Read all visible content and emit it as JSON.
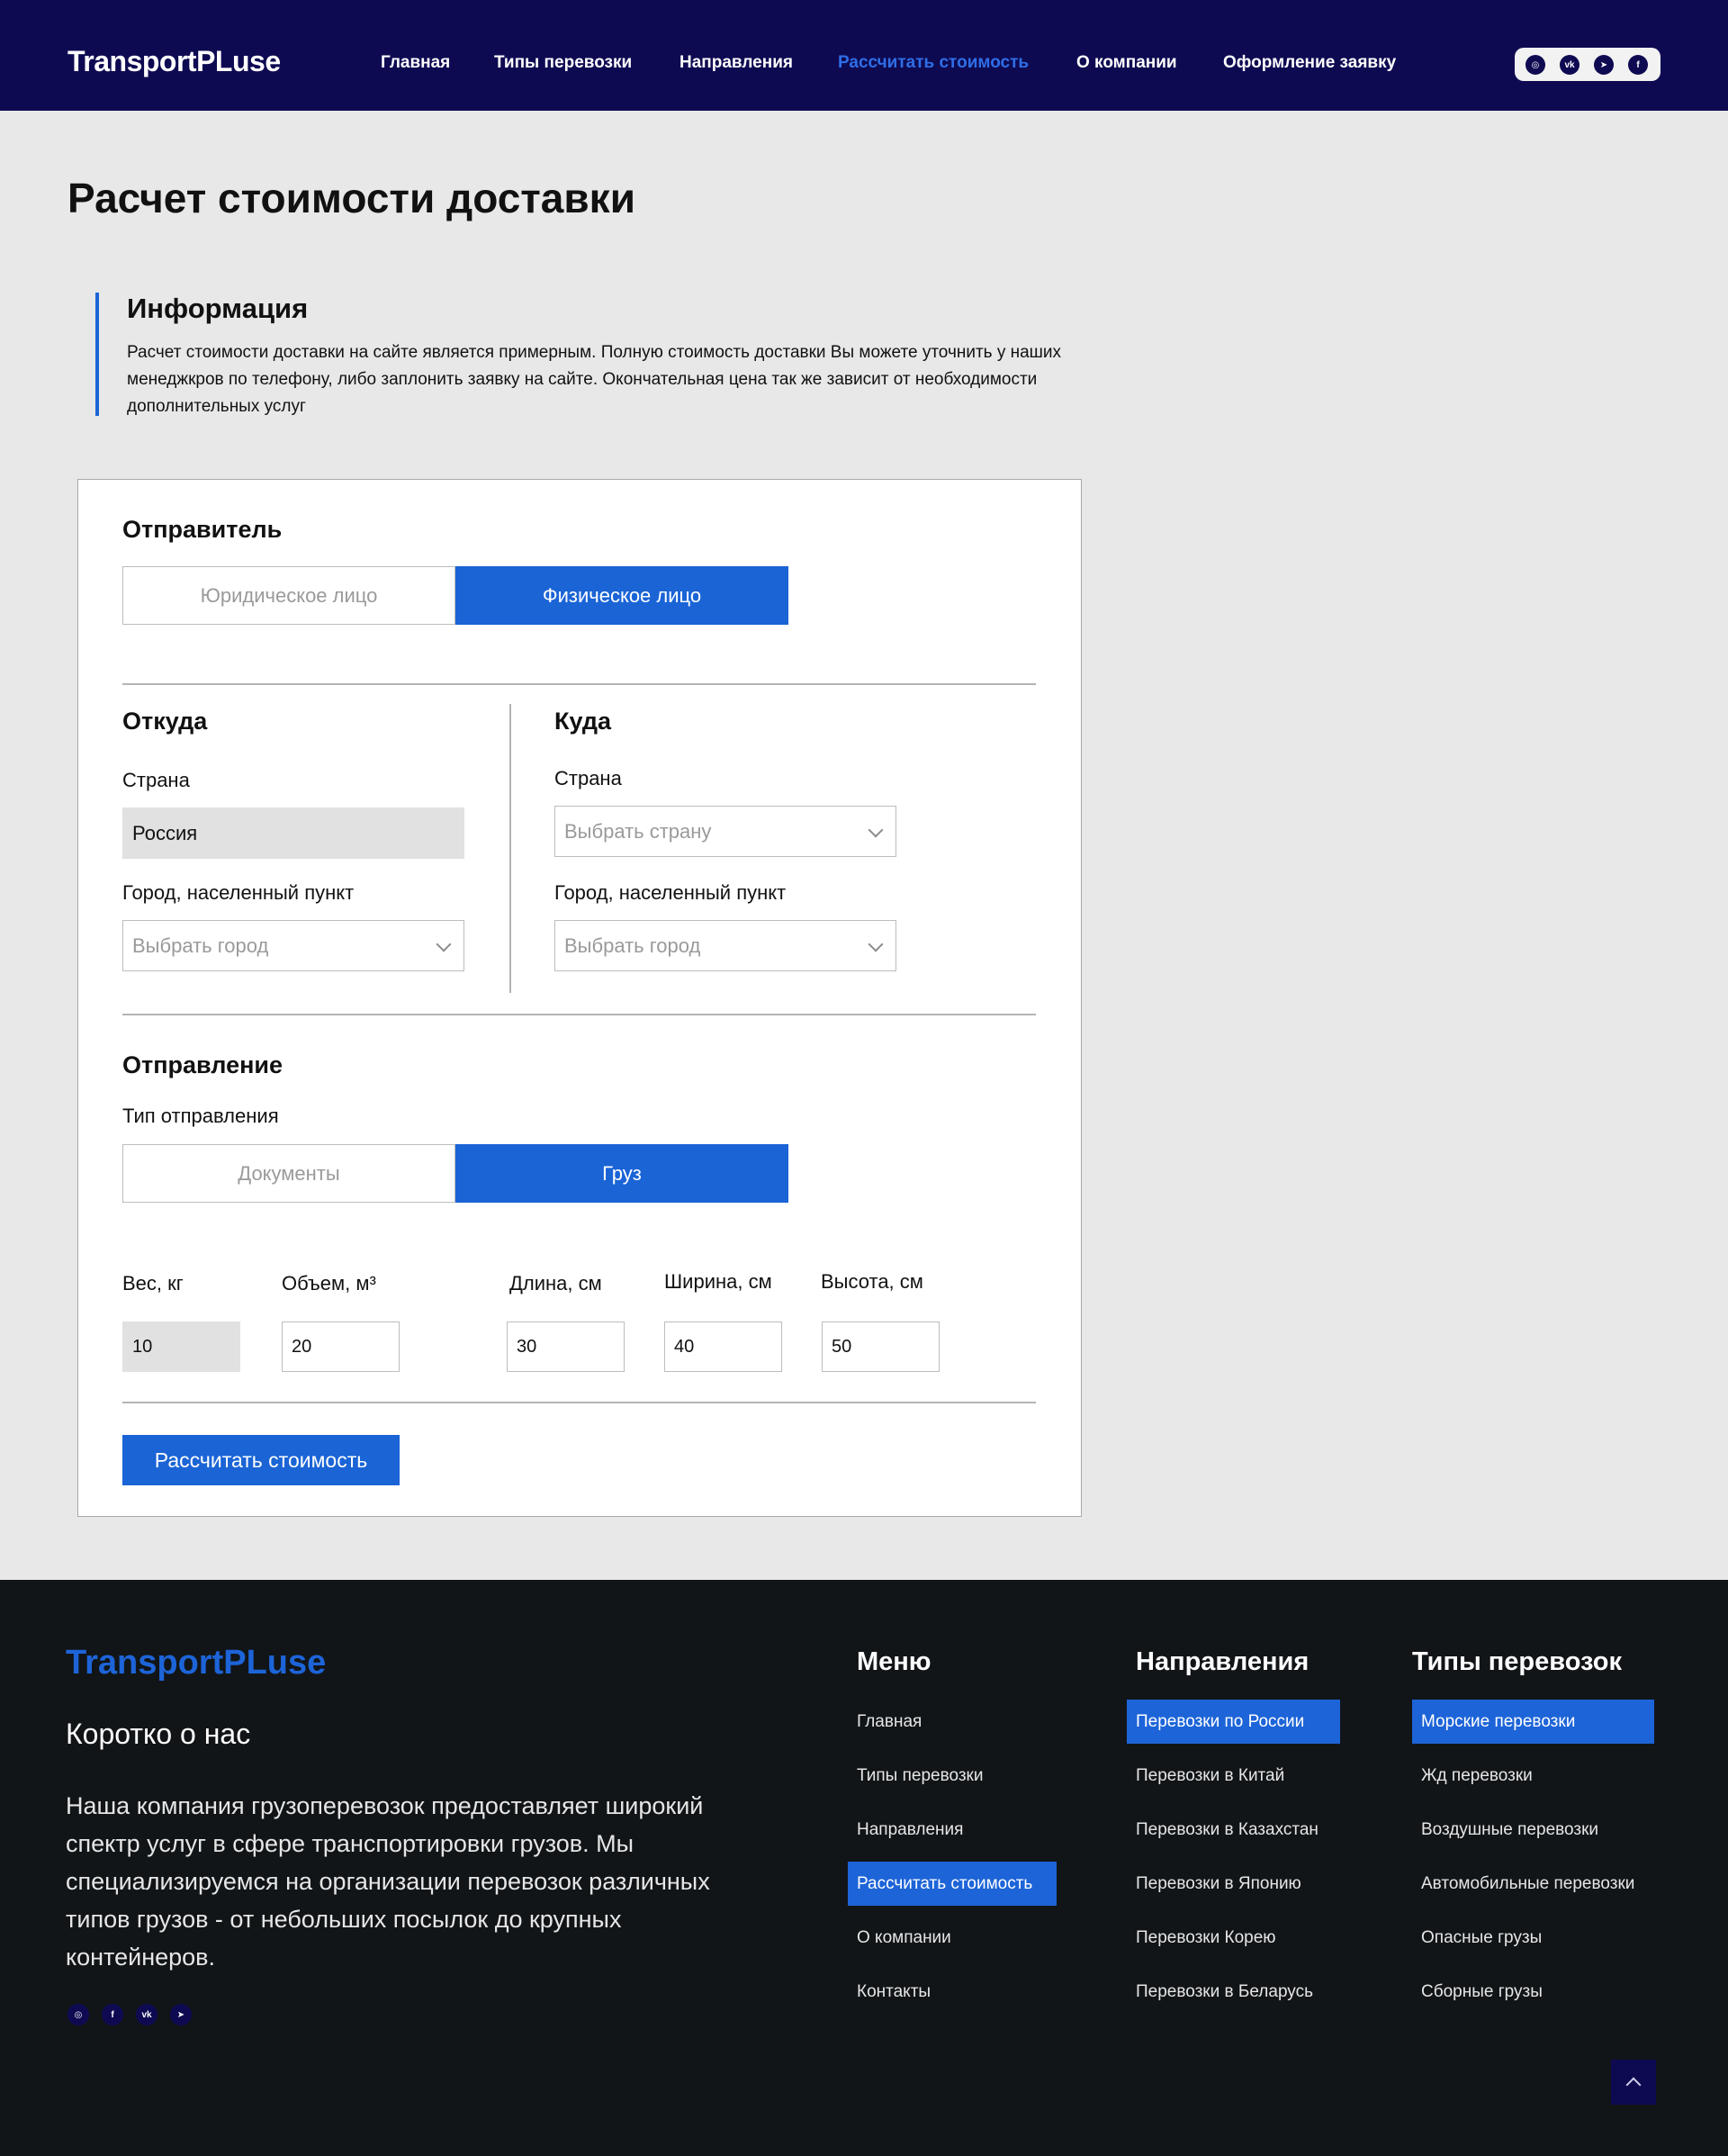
{
  "header": {
    "logo": "TransportPLuse",
    "nav": [
      "Главная",
      "Типы перевозки",
      "Направления",
      "Рассчитать стоимость",
      "О компании",
      "Оформление заявку"
    ],
    "active_nav": "Рассчитать стоимость",
    "social": [
      {
        "icon": "instagram-icon",
        "glyph": "◎"
      },
      {
        "icon": "vk-icon",
        "glyph": "vk"
      },
      {
        "icon": "telegram-icon",
        "glyph": "➤"
      },
      {
        "icon": "facebook-icon",
        "glyph": "f"
      }
    ]
  },
  "main": {
    "title": "Расчет стоимости доставки",
    "info": {
      "title": "Информация",
      "text": "Расчет стоимости доставки на сайте является примерным. Полную стоимость доставки Вы можете уточнить у наших менеджкров по телефону, либо заплонить заявку на сайте. Окончательная цена так же зависит от необходимости дополнительных услуг"
    },
    "form": {
      "sender": {
        "title": "Отправитель",
        "options": [
          "Юридическое лицо",
          "Физическое лицо"
        ],
        "selected": "Физическое лицо"
      },
      "from": {
        "title": "Откуда",
        "country_label": "Страна",
        "country_value": "Россия",
        "city_label": "Город, населенный пункт",
        "city_placeholder": "Выбрать город"
      },
      "to": {
        "title": "Куда",
        "country_label": "Страна",
        "country_placeholder": "Выбрать страну",
        "city_label": "Город, населенный пункт",
        "city_placeholder": "Выбрать город"
      },
      "shipment": {
        "title": "Отправление",
        "type_label": "Тип отправления",
        "options": [
          "Документы",
          "Груз"
        ],
        "selected": "Груз"
      },
      "dimensions": {
        "weight_label": "Вес, кг",
        "weight_value": "10",
        "volume_label": "Объем, м³",
        "volume_value": "20",
        "length_label": "Длина, см",
        "length_value": "30",
        "width_label": "Ширина, см",
        "width_value": "40",
        "height_label": "Высота, см",
        "height_value": "50"
      },
      "submit_label": "Рассчитать стоимость"
    }
  },
  "footer": {
    "logo": "TransportPLuse",
    "about_title": "Коротко о нас",
    "about_text": "Наша компания грузоперевозок предоставляет широкий спектр услуг в сфере транспортировки грузов. Мы специализируемся на организации перевозок различных типов грузов - от небольших посылок до крупных контейнеров.",
    "social": [
      {
        "icon": "instagram-icon",
        "glyph": "◎"
      },
      {
        "icon": "facebook-icon",
        "glyph": "f"
      },
      {
        "icon": "vk-icon",
        "glyph": "vk"
      },
      {
        "icon": "telegram-icon",
        "glyph": "➤"
      }
    ],
    "columns": [
      {
        "title": "Меню",
        "links": [
          "Главная",
          "Типы перевозки",
          "Направления",
          "Рассчитать стоимость",
          "О компании",
          "Контакты"
        ],
        "highlighted": "Рассчитать стоимость"
      },
      {
        "title": "Направления",
        "links": [
          "Перевозки по России",
          "Перевозки в Китай",
          "Перевозки в Казахстан",
          "Перевозки в Японию",
          "Перевозки Корею",
          "Перевозки в Беларусь"
        ],
        "highlighted": "Перевозки по России"
      },
      {
        "title": "Типы перевозок",
        "links": [
          "Морские перевозки",
          "Жд перевозки",
          "Воздушные перевозки",
          "Автомобильные перевозки",
          "Опасные грузы",
          "Сборные грузы"
        ],
        "highlighted": "Морские перевозки"
      }
    ]
  }
}
